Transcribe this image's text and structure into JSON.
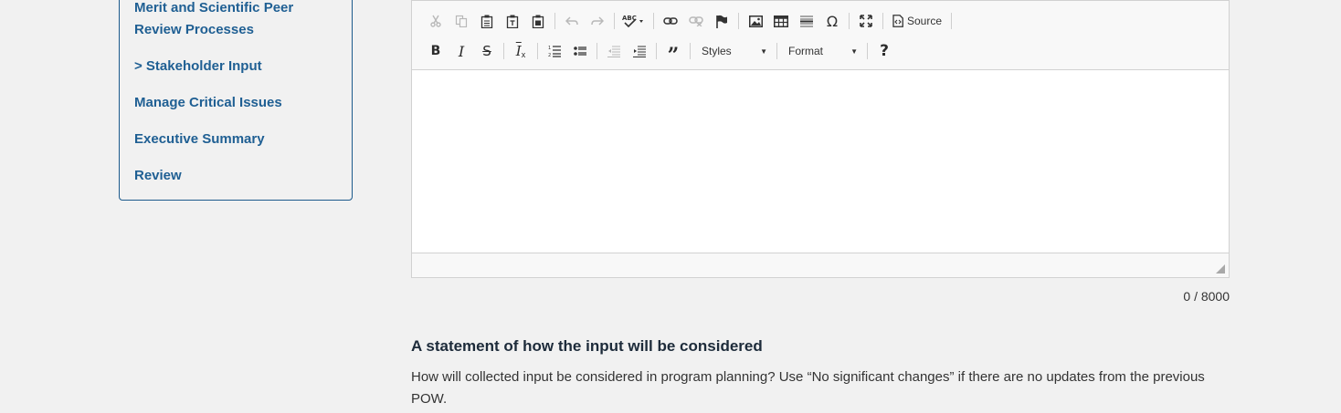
{
  "sidebar": {
    "items": [
      {
        "label": "Merit and Scientific Peer Review Processes"
      },
      {
        "label": "> Stakeholder Input"
      },
      {
        "label": "Manage Critical Issues"
      },
      {
        "label": "Executive Summary"
      },
      {
        "label": "Review"
      }
    ]
  },
  "editor": {
    "toolbar": {
      "row1": [
        "cut-icon",
        "copy-icon",
        "paste-icon",
        "paste-text-icon",
        "paste-word-icon",
        "undo-icon",
        "redo-icon",
        "spellcheck-icon",
        "link-icon",
        "unlink-icon",
        "anchor-icon",
        "image-icon",
        "table-icon",
        "horizontal-rule-icon",
        "special-char-icon",
        "maximize-icon",
        "source-icon"
      ],
      "source_label": "Source",
      "styles_label": "Styles",
      "format_label": "Format",
      "help_label": "?"
    },
    "char_count": "0 / 8000"
  },
  "section": {
    "title": "A statement of how the input will be considered",
    "description": "How will collected input be considered in program planning? Use “No significant changes” if there are no updates from the previous POW."
  },
  "colors": {
    "link": "#1f5f93",
    "border": "#1c5a8c",
    "background": "#f1f1f1"
  }
}
